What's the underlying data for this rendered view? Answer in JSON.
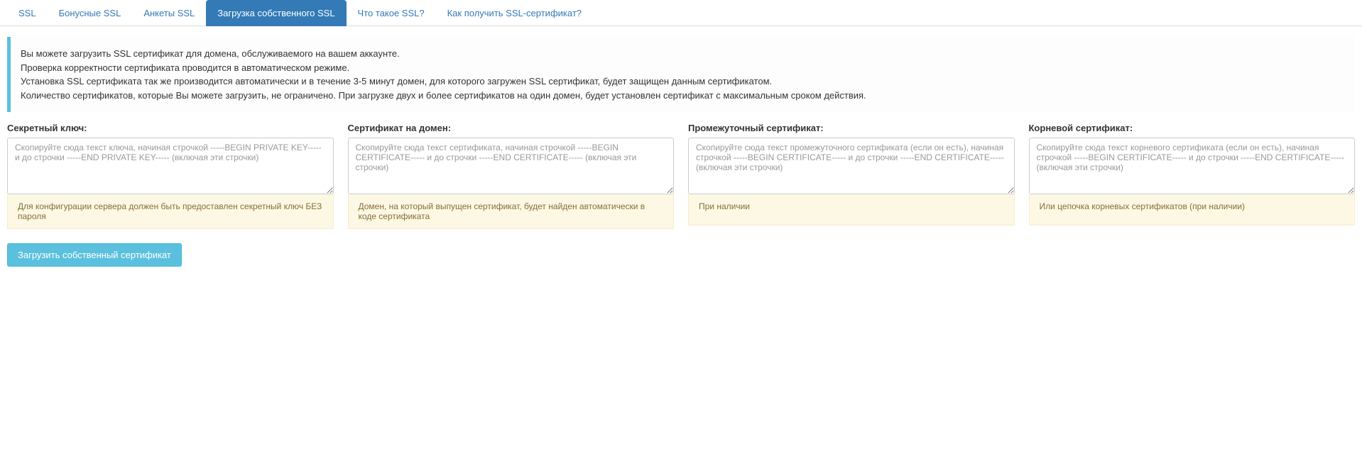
{
  "tabs": [
    {
      "label": "SSL",
      "active": false
    },
    {
      "label": "Бонусные SSL",
      "active": false
    },
    {
      "label": "Анкеты SSL",
      "active": false
    },
    {
      "label": "Загрузка собственного SSL",
      "active": true
    },
    {
      "label": "Что такое SSL?",
      "active": false
    },
    {
      "label": "Как получить SSL-сертификат?",
      "active": false
    }
  ],
  "info": {
    "line1": "Вы можете загрузить SSL сертификат для домена, обслуживаемого на вашем аккаунте.",
    "line2": "Проверка корректности сертификата проводится в автоматическом режиме.",
    "line3": "Установка SSL сертификата так же производится автоматически и в течение 3-5 минут домен, для которого загружен SSL сертификат, будет защищен данным сертификатом.",
    "line4": "Количество сертификатов, которые Вы можете загрузить, не ограничено. При загрузке двух и более сертификатов на один домен, будет установлен сертификат с максимальным сроком действия."
  },
  "fields": {
    "privateKey": {
      "label": "Секретный ключ:",
      "placeholder": "Скопируйте сюда текст ключа, начиная строчкой -----BEGIN PRIVATE KEY----- и до строчки -----END PRIVATE KEY----- (включая эти строчки)",
      "help": "Для конфигурации сервера должен быть предоставлен секретный ключ БЕЗ пароля"
    },
    "domainCert": {
      "label": "Сертификат на домен:",
      "placeholder": "Скопируйте сюда текст сертификата, начиная строчкой -----BEGIN CERTIFICATE----- и до строчки -----END CERTIFICATE----- (включая эти строчки)",
      "help": "Домен, на который выпущен сертификат, будет найден автоматически в коде сертификата"
    },
    "intermediateCert": {
      "label": "Промежуточный сертификат:",
      "placeholder": "Скопируйте сюда текст промежуточного сертификата (если он есть), начиная строчкой -----BEGIN CERTIFICATE----- и до строчки -----END CERTIFICATE----- (включая эти строчки)",
      "help": "При наличии"
    },
    "rootCert": {
      "label": "Корневой сертификат:",
      "placeholder": "Скопируйте сюда текст корневого сертификата (если он есть), начиная строчкой -----BEGIN CERTIFICATE----- и до строчки -----END CERTIFICATE----- (включая эти строчки)",
      "help": "Или цепочка корневых сертификатов (при наличии)"
    }
  },
  "submitLabel": "Загрузить собственный сертификат"
}
